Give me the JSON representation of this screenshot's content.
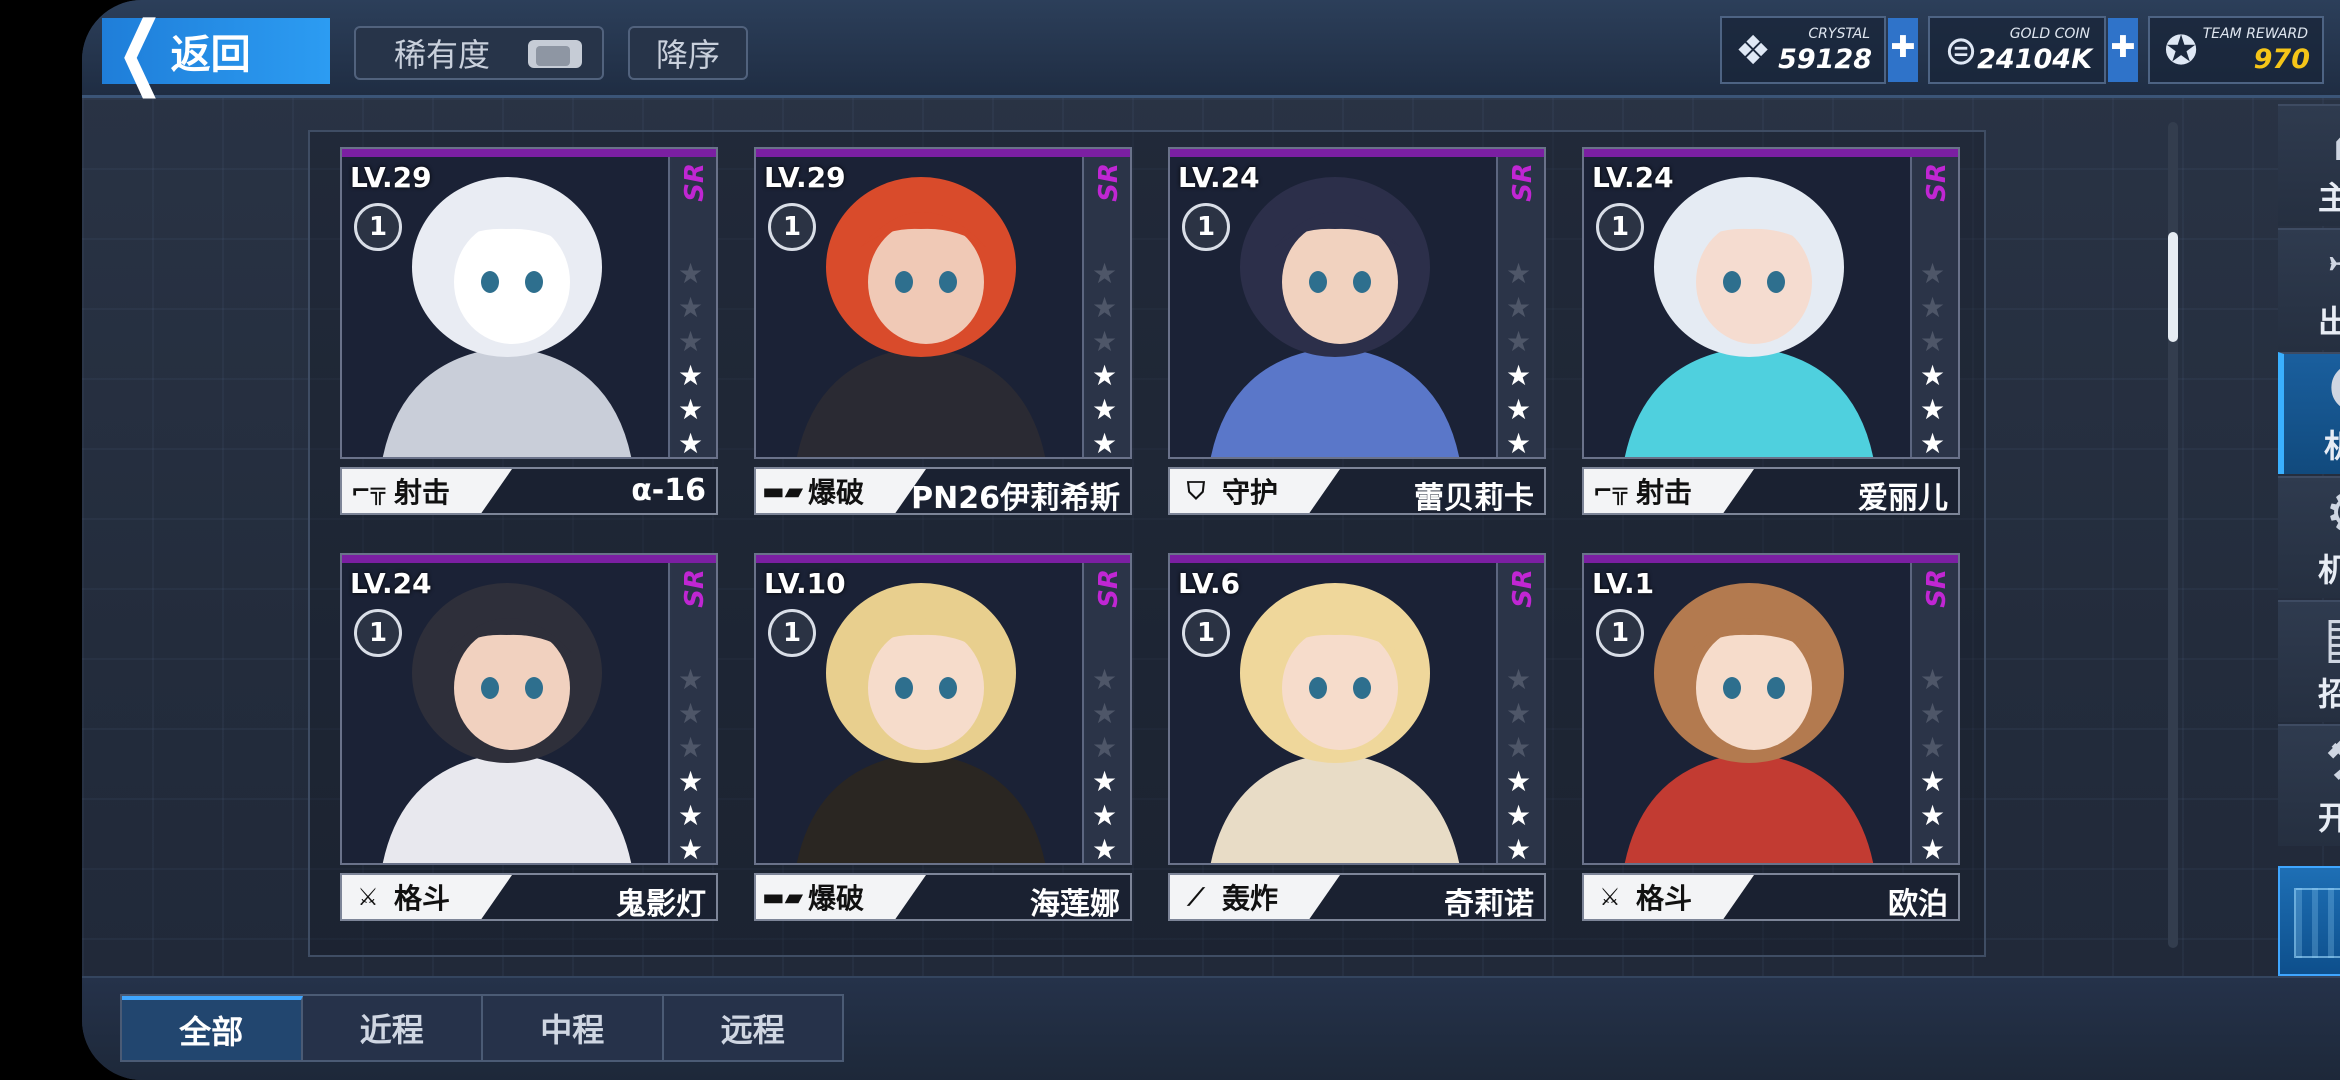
{
  "header": {
    "back_label": "返回",
    "rarity_label": "稀有度",
    "sort_label": "降序",
    "resources": [
      {
        "label": "CRYSTAL",
        "value": "59128",
        "icon": "crystal-icon"
      },
      {
        "label": "GOLD COIN",
        "value": "24104K",
        "icon": "gold-coin-icon"
      },
      {
        "label": "TEAM REWARD",
        "value": "970",
        "icon": "team-reward-icon",
        "color": "#f5c518"
      }
    ]
  },
  "cards": [
    {
      "level": "LV.29",
      "rank": "1",
      "rarity": "SR",
      "type": "射击",
      "type_icon": "rifle-icon",
      "name": "α-16",
      "stars": 3
    },
    {
      "level": "LV.29",
      "rank": "1",
      "rarity": "SR",
      "type": "爆破",
      "type_icon": "launcher-icon",
      "name": "PN26伊莉希斯",
      "stars": 3
    },
    {
      "level": "LV.24",
      "rank": "1",
      "rarity": "SR",
      "type": "守护",
      "type_icon": "shield-icon",
      "name": "蕾贝莉卡",
      "stars": 3
    },
    {
      "level": "LV.24",
      "rank": "1",
      "rarity": "SR",
      "type": "射击",
      "type_icon": "rifle-icon",
      "name": "爱丽儿",
      "stars": 3
    },
    {
      "level": "LV.24",
      "rank": "1",
      "rarity": "SR",
      "type": "格斗",
      "type_icon": "crossed-swords-icon",
      "name": "鬼影灯",
      "stars": 3
    },
    {
      "level": "LV.10",
      "rank": "1",
      "rarity": "SR",
      "type": "爆破",
      "type_icon": "launcher-icon",
      "name": "海莲娜",
      "stars": 3
    },
    {
      "level": "LV.6",
      "rank": "1",
      "rarity": "SR",
      "type": "轰炸",
      "type_icon": "mortar-icon",
      "name": "奇莉诺",
      "stars": 3
    },
    {
      "level": "LV.1",
      "rank": "1",
      "rarity": "SR",
      "type": "格斗",
      "type_icon": "crossed-swords-icon",
      "name": "欧泊",
      "stars": 3
    }
  ],
  "sidenav": [
    {
      "label": "主厅",
      "icon": "hall-icon"
    },
    {
      "label": "出战",
      "icon": "sortie-icon"
    },
    {
      "label": "机师",
      "icon": "pilot-icon",
      "active": true
    },
    {
      "label": "机库",
      "icon": "hangar-icon"
    },
    {
      "label": "招募",
      "icon": "recruit-icon"
    },
    {
      "label": "开发",
      "icon": "develop-icon"
    }
  ],
  "tabs": [
    {
      "label": "全部",
      "active": true
    },
    {
      "label": "近程"
    },
    {
      "label": "中程"
    },
    {
      "label": "远程"
    }
  ]
}
